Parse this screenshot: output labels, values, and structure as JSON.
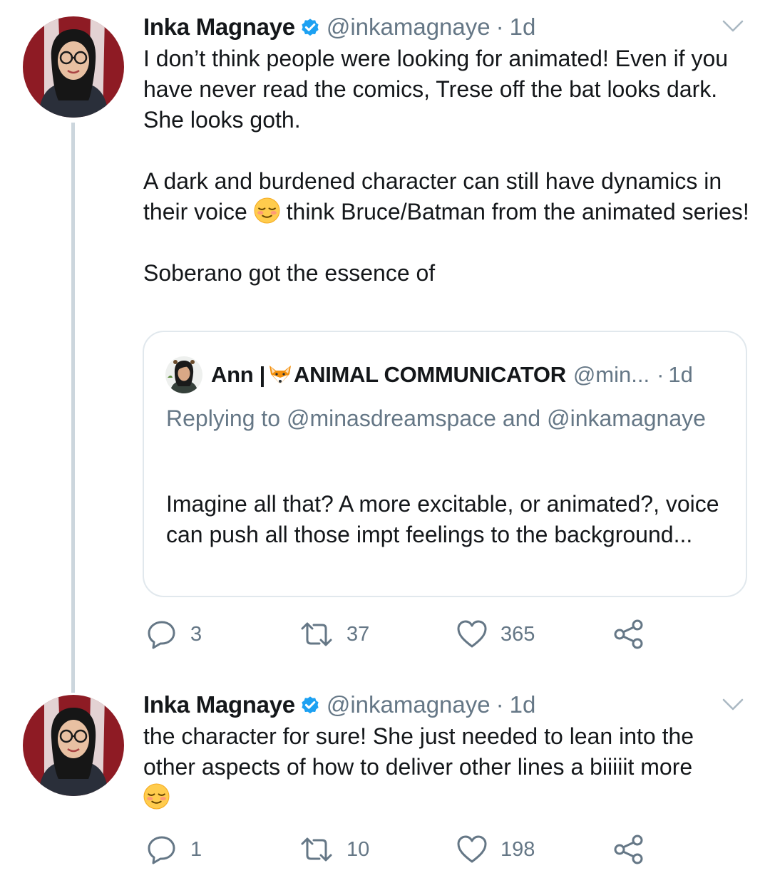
{
  "tweets": [
    {
      "name": "Inka Magnaye",
      "handle": "@inkamagnaye",
      "separator": "·",
      "time": "1d",
      "paragraphs": [
        "I don’t think people were looking for animated! Even if you have never read the comics, Trese off the bat looks dark. She looks goth.",
        "A dark and burdened character can still have dynamics in their voice",
        "think Bruce/Batman from the animated series!",
        "Soberano got the essence of"
      ],
      "stats": {
        "replies": "3",
        "retweets": "37",
        "likes": "365"
      }
    },
    {
      "name": "Inka Magnaye",
      "handle": "@inkamagnaye",
      "separator": "·",
      "time": "1d",
      "text": "the character for sure! She just needed to lean into the other aspects of how to deliver other lines a biiiiit more",
      "stats": {
        "replies": "1",
        "retweets": "10",
        "likes": "198"
      }
    }
  ],
  "quoted_tweet": {
    "name_prefix": "Ann |",
    "name_suffix": "ANIMAL COMMUNICATOR",
    "handle": "@min...",
    "separator": "·",
    "time": "1d",
    "replying_to": "Replying to @minasdreamspace and @inkamagnaye",
    "text": "Imagine all that? A more excitable, or animated?, voice can push all those impt feelings to the background..."
  },
  "icons": {
    "verified": "verified-badge-icon",
    "more": "chevron-down-icon",
    "reply": "reply-icon",
    "retweet": "retweet-icon",
    "like": "heart-icon",
    "share": "share-icon",
    "emoji": "relieved-face-emoji",
    "fox": "fox-emoji"
  },
  "colors": {
    "text": "#14171a",
    "secondary": "#657786",
    "verified": "#1da1f2",
    "border": "#e1e8ed",
    "thread_line": "#ccd6dd"
  }
}
